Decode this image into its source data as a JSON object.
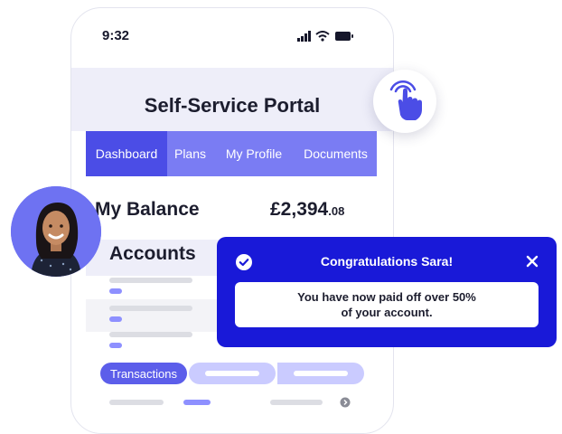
{
  "status_bar": {
    "time": "9:32"
  },
  "portal": {
    "title": "Self-Service Portal"
  },
  "tabs": [
    {
      "label": "Dashboard",
      "active": true
    },
    {
      "label": "Plans",
      "active": false
    },
    {
      "label": "My Profile",
      "active": false
    },
    {
      "label": "Documents",
      "active": false
    }
  ],
  "balance": {
    "label": "My Balance",
    "pounds": "£2,394",
    "pence": ".08"
  },
  "accounts": {
    "label": "Accounts"
  },
  "segments": {
    "active_label": "Transactions"
  },
  "toast": {
    "title": "Congratulations Sara!",
    "message_line1": "You have now paid off over 50%",
    "message_line2": "of your account."
  },
  "colors": {
    "accent": "#4b4de6",
    "tab_bar": "#7a7cf3",
    "toast": "#1919d8"
  },
  "icons": [
    "signal-icon",
    "wifi-icon",
    "battery-icon",
    "touch-hand-icon",
    "check-circle-icon",
    "close-icon",
    "chevron-right-icon"
  ]
}
